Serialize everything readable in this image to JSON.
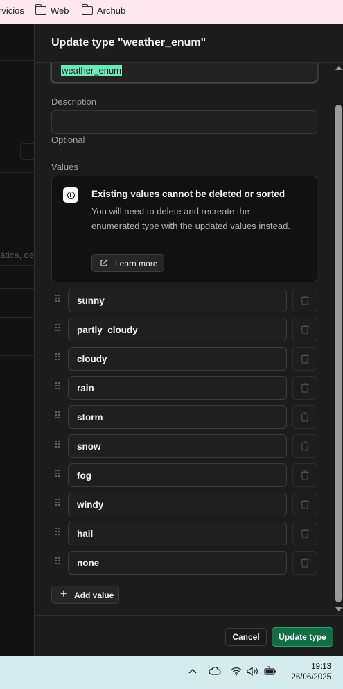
{
  "bookmarks_bar": {
    "items": [
      {
        "label": "rvicios",
        "icon": "folder-icon"
      },
      {
        "label": "Web",
        "icon": "folder-icon"
      },
      {
        "label": "Archub",
        "icon": "folder-icon"
      }
    ]
  },
  "background": {
    "partial_text": "ática, de"
  },
  "dialog": {
    "title": "Update type \"weather_enum\"",
    "name_value": "weather_enum",
    "description_label": "Description",
    "description_value": "",
    "description_hint": "Optional",
    "values_label": "Values",
    "alert": {
      "title": "Existing values cannot be deleted or sorted",
      "body": "You will need to delete and recreate the enumerated type with the updated values instead.",
      "learn_more": "Learn more"
    },
    "values": [
      "sunny",
      "partly_cloudy",
      "cloudy",
      "rain",
      "storm",
      "snow",
      "fog",
      "windy",
      "hail",
      "none"
    ],
    "add_value": "Add value",
    "cancel": "Cancel",
    "submit": "Update type"
  },
  "taskbar": {
    "time": "19:13",
    "date": "26/06/2025",
    "tray_icons": [
      "chevron-up-icon",
      "cloud-icon",
      "wifi-icon",
      "speaker-icon",
      "battery-icon"
    ]
  },
  "colors": {
    "accent": "#0f6e45",
    "selection": "#6ee7b7",
    "panel": "#1c1c1c",
    "bookmarks_bg": "#fce8ee",
    "taskbar_bg": "#d4ecef"
  }
}
